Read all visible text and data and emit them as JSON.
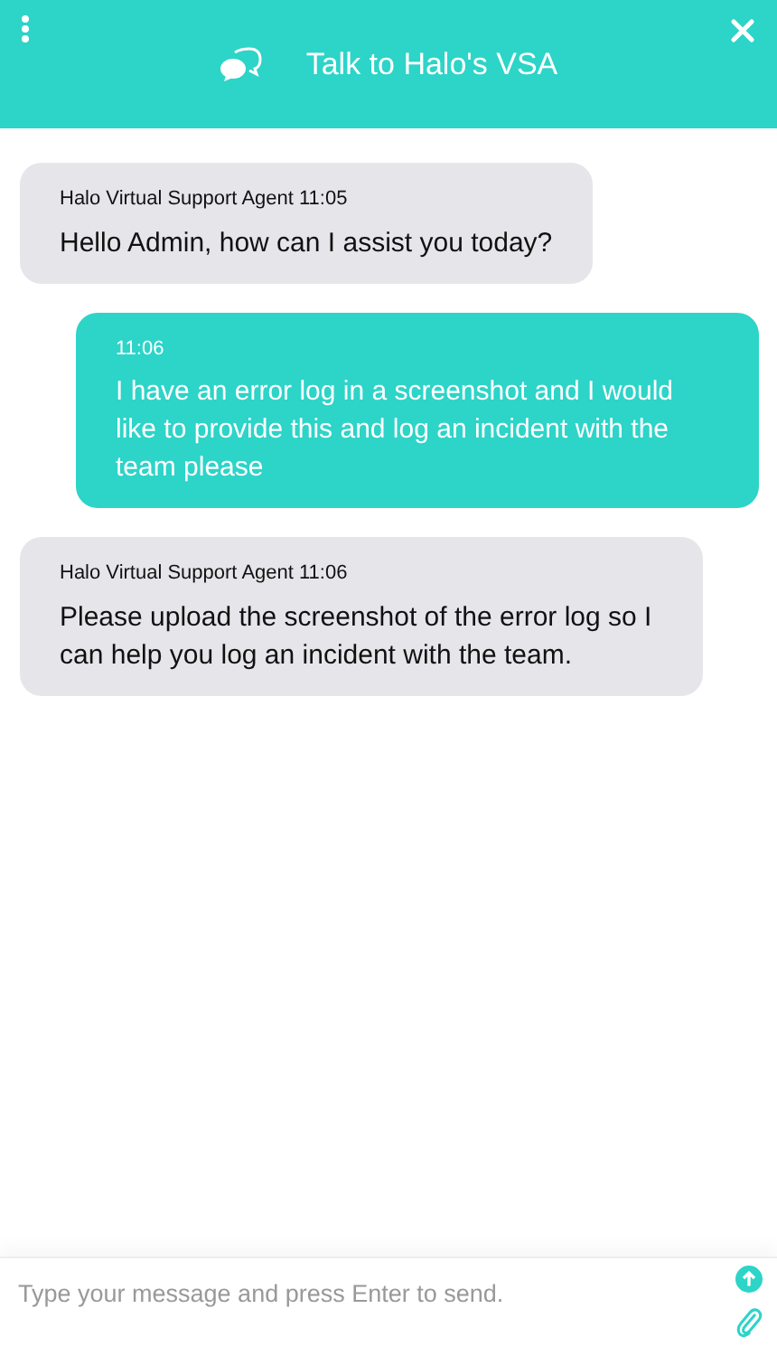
{
  "header": {
    "title": "Talk to Halo's VSA"
  },
  "messages": [
    {
      "kind": "agent",
      "meta": "Halo Virtual Support Agent 11:05",
      "text": "Hello Admin, how can I assist you today?"
    },
    {
      "kind": "user",
      "meta": "11:06",
      "text": "I have an error log in a screenshot and I would like to provide this and log an incident with the team please"
    },
    {
      "kind": "agent",
      "meta": "Halo Virtual Support Agent 11:06",
      "text": "Please upload the screenshot of the error log so I can help you log an incident with the team."
    }
  ],
  "composer": {
    "placeholder": "Type your message and press Enter to send."
  }
}
